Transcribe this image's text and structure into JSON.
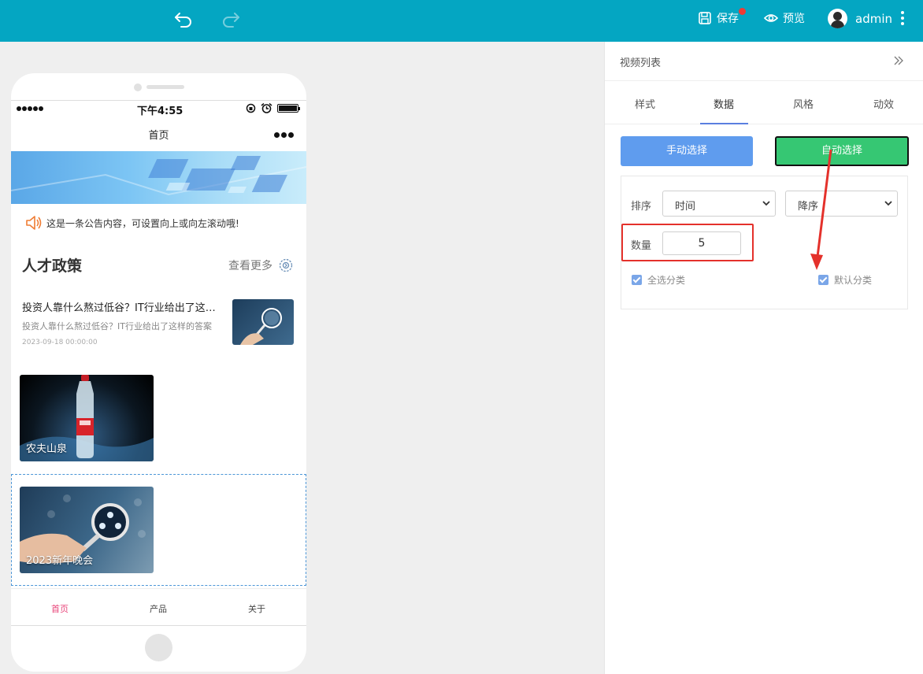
{
  "toolbar": {
    "save_label": "保存",
    "preview_label": "预览",
    "username": "admin"
  },
  "phone": {
    "status_time": "下午4:55",
    "page_title": "首页",
    "notice_text": "这是一条公告内容，可设置向上或向左滚动哦!",
    "section_title": "人才政策",
    "see_more": "查看更多",
    "article": {
      "title": "投资人靠什么熬过低谷？IT行业给出了这样的答案",
      "summary": "投资人靠什么熬过低谷？IT行业给出了这样的答案",
      "date": "2023-09-18 00:00:00"
    },
    "videos": [
      {
        "caption": "农夫山泉"
      },
      {
        "caption": "2023新年晚会"
      }
    ],
    "tabs": [
      {
        "label": "首页"
      },
      {
        "label": "产品"
      },
      {
        "label": "关于"
      }
    ]
  },
  "panel": {
    "title": "视频列表",
    "tabs": [
      {
        "label": "样式"
      },
      {
        "label": "数据"
      },
      {
        "label": "风格"
      },
      {
        "label": "动效"
      }
    ],
    "manual_button": "手动选择",
    "auto_button": "自动选择",
    "sort_label": "排序",
    "sort_field": "时间",
    "sort_order": "降序",
    "quantity_label": "数量",
    "quantity_value": "5",
    "check_all_label": "全选分类",
    "default_category_label": "默认分类"
  },
  "colors": {
    "topbar": "#04a6c2",
    "manual_button": "#5f9cee",
    "auto_button": "#36c773",
    "highlight": "#e4312b",
    "active_tab": "#e8457a"
  }
}
